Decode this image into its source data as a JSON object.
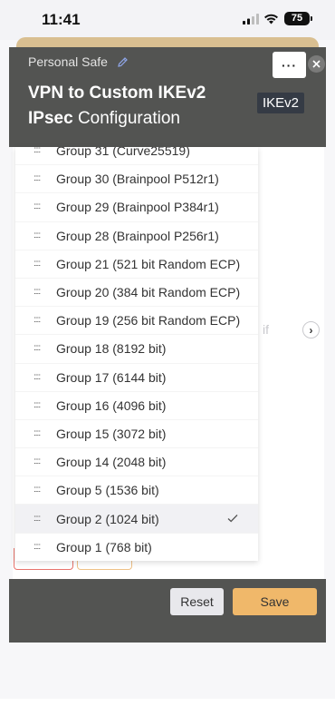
{
  "status_bar": {
    "time": "11:41",
    "battery": "75"
  },
  "background": {
    "partial_text": "if"
  },
  "modal": {
    "subtitle": "Personal Safe",
    "title_bold": "VPN to Custom IKEv2",
    "title_bold_2": "IPsec",
    "title_rest": "Configuration",
    "badge": "IKEv2",
    "more_label": "···",
    "colors": {
      "header_bg": "#535452",
      "save_bg": "#f0b86a",
      "badge_bg": "#353b45"
    }
  },
  "dropdown": {
    "handle": "::::",
    "options": [
      {
        "label": "Group 31 (Curve25519)",
        "selected": false
      },
      {
        "label": "Group 30 (Brainpool P512r1)",
        "selected": false
      },
      {
        "label": "Group 29 (Brainpool P384r1)",
        "selected": false
      },
      {
        "label": "Group 28 (Brainpool P256r1)",
        "selected": false
      },
      {
        "label": "Group 21 (521 bit Random ECP)",
        "selected": false
      },
      {
        "label": "Group 20 (384 bit Random ECP)",
        "selected": false
      },
      {
        "label": "Group 19 (256 bit Random ECP)",
        "selected": false
      },
      {
        "label": "Group 18 (8192 bit)",
        "selected": false
      },
      {
        "label": "Group 17 (6144 bit)",
        "selected": false
      },
      {
        "label": "Group 16 (4096 bit)",
        "selected": false
      },
      {
        "label": "Group 15 (3072 bit)",
        "selected": false
      },
      {
        "label": "Group 14 (2048 bit)",
        "selected": false
      },
      {
        "label": "Group 5 (1536 bit)",
        "selected": false
      },
      {
        "label": "Group 2 (1024 bit)",
        "selected": true
      },
      {
        "label": "Group 1 (768 bit)",
        "selected": false
      }
    ],
    "selected_icon": "checkmark-icon"
  },
  "footer": {
    "reset_label": "Reset",
    "save_label": "Save"
  }
}
